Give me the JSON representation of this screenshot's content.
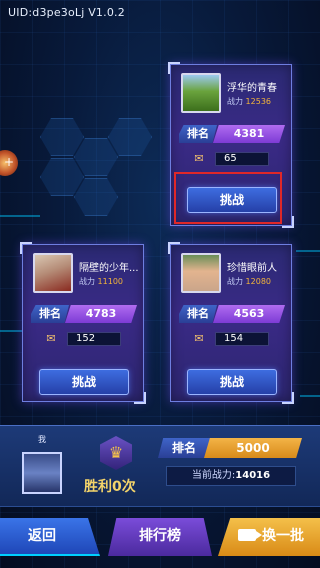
{
  "header": {
    "uid_version": "UID:d3pe3oLj V1.0.2"
  },
  "side_marker": "+",
  "opponents": [
    {
      "name": "浮华的青春",
      "power_label": "战力",
      "power": "12536",
      "rank_label": "排名",
      "rank": "4381",
      "votes": "65",
      "challenge_label": "挑战"
    },
    {
      "name": "隔壁的少年...",
      "power_label": "战力",
      "power": "11100",
      "rank_label": "排名",
      "rank": "4783",
      "votes": "152",
      "challenge_label": "挑战"
    },
    {
      "name": "珍惜眼前人",
      "power_label": "战力",
      "power": "12080",
      "rank_label": "排名",
      "rank": "4563",
      "votes": "154",
      "challenge_label": "挑战"
    }
  ],
  "me": {
    "label": "我",
    "wins": "胜利0次",
    "rank_label": "排名",
    "rank": "5000",
    "power_label": "当前战力:",
    "power": "14016"
  },
  "nav": {
    "back_label": "返回",
    "leaderboard_label": "排行榜",
    "swap_label": "换一批"
  },
  "icons": {
    "trophy": "trophy-icon",
    "vote": "thumb-icon",
    "camera": "video-icon"
  },
  "colors": {
    "accent_purple": "#7d3bd5",
    "accent_gold": "#d88a1a",
    "button_blue": "#2540a8",
    "highlight_red": "#e02828"
  }
}
